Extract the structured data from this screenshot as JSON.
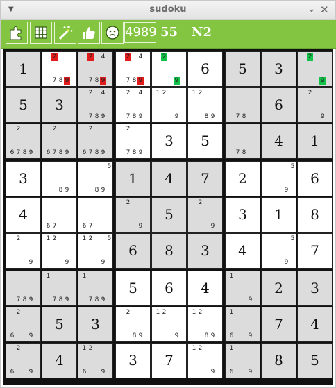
{
  "window": {
    "title": "sudoku",
    "menu_icon": "triangle-down",
    "minimize_icon": "minimize",
    "close_icon": "close"
  },
  "toolbar": {
    "buttons": [
      {
        "name": "puzzle-button",
        "icon": "puzzle-icon"
      },
      {
        "name": "grid-button",
        "icon": "grid-icon"
      },
      {
        "name": "magic-wand-button",
        "icon": "magic-wand-icon"
      },
      {
        "name": "thumbs-up-button",
        "icon": "thumbs-up-icon"
      },
      {
        "name": "sad-face-button",
        "icon": "sad-face-icon"
      }
    ],
    "counter": "4989",
    "score": "55",
    "level": "N2"
  },
  "colors": {
    "toolbar": "#83c540",
    "cell_gray": "#dcdcdc",
    "cell_white": "#ffffff",
    "highlight_red": "#e21b1b",
    "highlight_green": "#12c248"
  },
  "board": [
    [
      {
        "bg": "gray",
        "value": "1"
      },
      {
        "bg": "white",
        "cands": [
          "2",
          "7",
          "8",
          "9"
        ],
        "hl": {
          "2": "red",
          "9": "red"
        }
      },
      {
        "bg": "gray",
        "cands": [
          "2",
          "4",
          "7",
          "8",
          "9"
        ],
        "hl": {
          "2": "red",
          "9": "red"
        }
      },
      {
        "bg": "white",
        "cands": [
          "2",
          "4",
          "7",
          "8",
          "9"
        ],
        "hl": {
          "2": "red",
          "9": "red"
        }
      },
      {
        "bg": "white",
        "cands": [
          "2",
          "9"
        ],
        "hl": {
          "2": "green",
          "9": "green"
        }
      },
      {
        "bg": "white",
        "value": "6"
      },
      {
        "bg": "gray",
        "value": "5"
      },
      {
        "bg": "gray",
        "value": "3"
      },
      {
        "bg": "gray",
        "cands": [
          "2",
          "9"
        ],
        "hl": {
          "2": "green",
          "9": "green"
        }
      }
    ],
    [
      {
        "bg": "gray",
        "value": "5"
      },
      {
        "bg": "gray",
        "value": "3"
      },
      {
        "bg": "gray",
        "cands": [
          "2",
          "4",
          "7",
          "8",
          "9"
        ]
      },
      {
        "bg": "white",
        "cands": [
          "2",
          "4",
          "7",
          "8",
          "9"
        ]
      },
      {
        "bg": "white",
        "cands": [
          "1",
          "2",
          "9"
        ]
      },
      {
        "bg": "white",
        "cands": [
          "1",
          "2",
          "8",
          "9"
        ]
      },
      {
        "bg": "gray",
        "cands": [
          "7",
          "8"
        ]
      },
      {
        "bg": "gray",
        "value": "6"
      },
      {
        "bg": "gray",
        "cands": [
          "2",
          "9"
        ]
      }
    ],
    [
      {
        "bg": "gray",
        "cands": [
          "2",
          "6",
          "7",
          "8",
          "9"
        ]
      },
      {
        "bg": "gray",
        "cands": [
          "2",
          "6",
          "7",
          "8",
          "9"
        ]
      },
      {
        "bg": "gray",
        "cands": [
          "2",
          "6",
          "7",
          "8",
          "9"
        ]
      },
      {
        "bg": "white",
        "cands": [
          "2",
          "7",
          "8",
          "9"
        ]
      },
      {
        "bg": "white",
        "value": "3"
      },
      {
        "bg": "white",
        "value": "5"
      },
      {
        "bg": "gray",
        "cands": [
          "7",
          "8"
        ]
      },
      {
        "bg": "gray",
        "value": "4"
      },
      {
        "bg": "gray",
        "value": "1"
      }
    ],
    [
      {
        "bg": "white",
        "value": "3"
      },
      {
        "bg": "white",
        "cands": [
          "8",
          "9"
        ]
      },
      {
        "bg": "white",
        "cands": [
          "5",
          "8",
          "9"
        ]
      },
      {
        "bg": "gray",
        "value": "1"
      },
      {
        "bg": "gray",
        "value": "4"
      },
      {
        "bg": "gray",
        "value": "7"
      },
      {
        "bg": "white",
        "value": "2"
      },
      {
        "bg": "white",
        "cands": [
          "5",
          "9"
        ]
      },
      {
        "bg": "white",
        "value": "6"
      }
    ],
    [
      {
        "bg": "white",
        "value": "4"
      },
      {
        "bg": "white",
        "cands": [
          "6",
          "7"
        ]
      },
      {
        "bg": "white",
        "cands": [
          "6",
          "7"
        ]
      },
      {
        "bg": "gray",
        "cands": [
          "2",
          "9"
        ]
      },
      {
        "bg": "gray",
        "value": "5"
      },
      {
        "bg": "gray",
        "cands": [
          "2",
          "9"
        ]
      },
      {
        "bg": "white",
        "value": "3"
      },
      {
        "bg": "white",
        "value": "1"
      },
      {
        "bg": "white",
        "value": "8"
      }
    ],
    [
      {
        "bg": "white",
        "cands": [
          "2",
          "9"
        ]
      },
      {
        "bg": "white",
        "cands": [
          "1",
          "2",
          "9"
        ]
      },
      {
        "bg": "white",
        "cands": [
          "1",
          "2",
          "5",
          "9"
        ]
      },
      {
        "bg": "gray",
        "value": "6"
      },
      {
        "bg": "gray",
        "value": "8"
      },
      {
        "bg": "gray",
        "value": "3"
      },
      {
        "bg": "white",
        "value": "4"
      },
      {
        "bg": "white",
        "cands": [
          "5",
          "9"
        ]
      },
      {
        "bg": "white",
        "value": "7"
      }
    ],
    [
      {
        "bg": "gray",
        "cands": [
          "7",
          "8",
          "9"
        ]
      },
      {
        "bg": "gray",
        "cands": [
          "1",
          "7",
          "8",
          "9"
        ]
      },
      {
        "bg": "gray",
        "cands": [
          "1",
          "7",
          "8",
          "9"
        ]
      },
      {
        "bg": "white",
        "value": "5"
      },
      {
        "bg": "white",
        "value": "6"
      },
      {
        "bg": "white",
        "value": "4"
      },
      {
        "bg": "gray",
        "cands": [
          "1",
          "9"
        ]
      },
      {
        "bg": "gray",
        "value": "2"
      },
      {
        "bg": "gray",
        "value": "3"
      }
    ],
    [
      {
        "bg": "gray",
        "cands": [
          "2",
          "6",
          "9"
        ]
      },
      {
        "bg": "gray",
        "value": "5"
      },
      {
        "bg": "gray",
        "value": "3"
      },
      {
        "bg": "white",
        "cands": [
          "2",
          "8",
          "9"
        ]
      },
      {
        "bg": "white",
        "cands": [
          "1",
          "2",
          "9"
        ]
      },
      {
        "bg": "white",
        "cands": [
          "1",
          "2",
          "8",
          "9"
        ]
      },
      {
        "bg": "gray",
        "cands": [
          "1",
          "6",
          "9"
        ]
      },
      {
        "bg": "gray",
        "value": "7"
      },
      {
        "bg": "gray",
        "value": "4"
      }
    ],
    [
      {
        "bg": "gray",
        "cands": [
          "2",
          "6",
          "9"
        ]
      },
      {
        "bg": "gray",
        "value": "4"
      },
      {
        "bg": "gray",
        "cands": [
          "1",
          "2",
          "6",
          "9"
        ]
      },
      {
        "bg": "white",
        "value": "3"
      },
      {
        "bg": "white",
        "value": "7"
      },
      {
        "bg": "white",
        "cands": [
          "1",
          "2",
          "9"
        ]
      },
      {
        "bg": "gray",
        "cands": [
          "1",
          "6",
          "9"
        ]
      },
      {
        "bg": "gray",
        "value": "8"
      },
      {
        "bg": "gray",
        "value": "5"
      }
    ]
  ]
}
